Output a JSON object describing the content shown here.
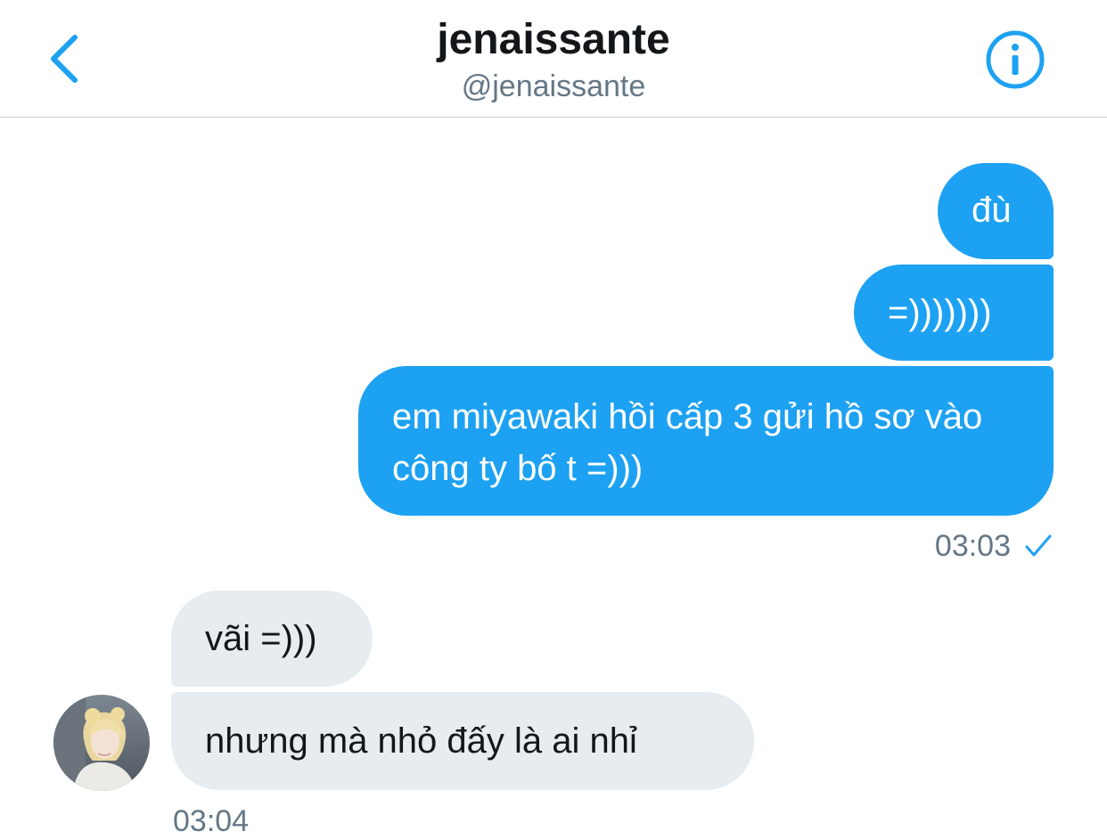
{
  "header": {
    "title": "jenaissante",
    "handle": "@jenaissante",
    "back_icon": "chevron-left-icon",
    "info_icon": "info-icon"
  },
  "colors": {
    "accent": "#1da1f2",
    "incoming_bubble": "#e6ecf0",
    "text_primary": "#14171a",
    "text_secondary": "#657786"
  },
  "messages": {
    "outgoing": [
      "đù",
      "=)))))))",
      "em miyawaki hồi cấp 3 gửi hồ sơ vào công ty bố t =)))"
    ],
    "outgoing_time": "03:03",
    "outgoing_status_icon": "checkmark-icon",
    "incoming": [
      "vãi =)))",
      "nhưng mà nhỏ đấy là ai nhỉ"
    ],
    "incoming_time": "03:04"
  }
}
